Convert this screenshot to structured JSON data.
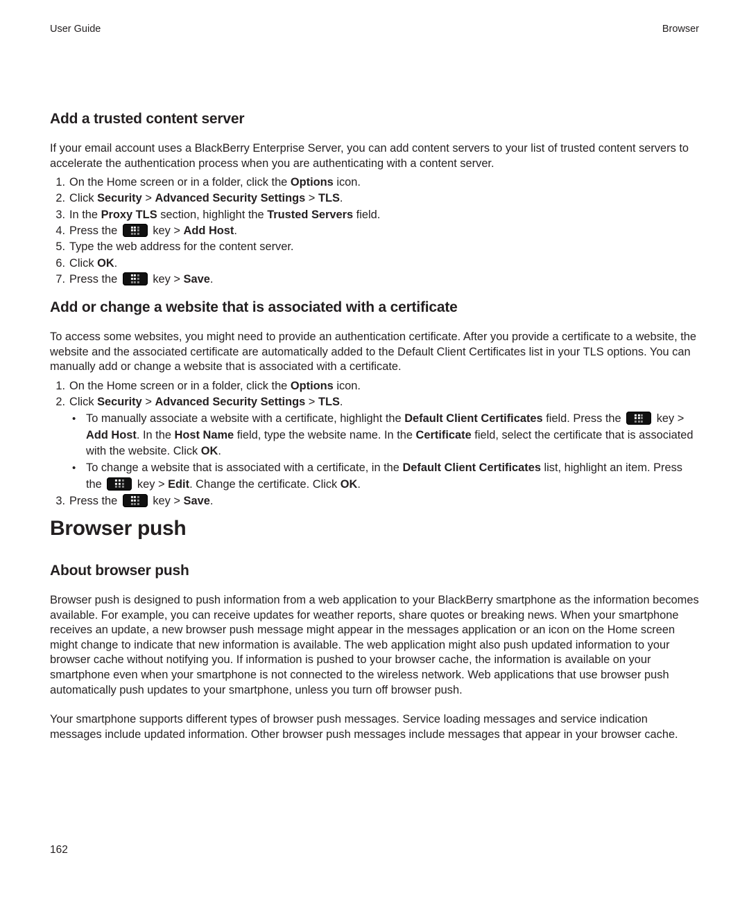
{
  "header": {
    "left": "User Guide",
    "right": "Browser"
  },
  "sections": [
    {
      "id": "trusted-content-server",
      "heading": "Add a trusted content server",
      "intro": "If your email account uses a BlackBerry Enterprise Server, you can add content servers to your list of trusted content servers to accelerate the authentication process when you are authenticating with a content server.",
      "steps": [
        {
          "num": "1.",
          "parts": [
            {
              "t": "On the Home screen or in a folder, click the "
            },
            {
              "t": "Options",
              "b": true
            },
            {
              "t": " icon."
            }
          ]
        },
        {
          "num": "2.",
          "parts": [
            {
              "t": "Click "
            },
            {
              "t": "Security",
              "b": true
            },
            {
              "t": " > "
            },
            {
              "t": "Advanced Security Settings",
              "b": true
            },
            {
              "t": " > "
            },
            {
              "t": "TLS",
              "b": true
            },
            {
              "t": "."
            }
          ]
        },
        {
          "num": "3.",
          "parts": [
            {
              "t": "In the "
            },
            {
              "t": "Proxy TLS",
              "b": true
            },
            {
              "t": " section, highlight the "
            },
            {
              "t": "Trusted Servers",
              "b": true
            },
            {
              "t": " field."
            }
          ]
        },
        {
          "num": "4.",
          "parts": [
            {
              "t": "Press the "
            },
            {
              "icon": "menu-key-icon"
            },
            {
              "t": " key > "
            },
            {
              "t": "Add Host",
              "b": true
            },
            {
              "t": "."
            }
          ]
        },
        {
          "num": "5.",
          "parts": [
            {
              "t": "Type the web address for the content server."
            }
          ]
        },
        {
          "num": "6.",
          "parts": [
            {
              "t": "Click "
            },
            {
              "t": "OK",
              "b": true
            },
            {
              "t": "."
            }
          ]
        },
        {
          "num": "7.",
          "parts": [
            {
              "t": "Press the "
            },
            {
              "icon": "menu-key-icon"
            },
            {
              "t": " key > "
            },
            {
              "t": "Save",
              "b": true
            },
            {
              "t": "."
            }
          ]
        }
      ]
    },
    {
      "id": "website-certificate",
      "heading": "Add or change a website that is associated with a certificate",
      "intro": "To access some websites, you might need to provide an authentication certificate. After you provide a certificate to a website, the website and the associated certificate are automatically added to the Default Client Certificates list in your TLS options. You can manually add or change a website that is associated with a certificate.",
      "steps": [
        {
          "num": "1.",
          "parts": [
            {
              "t": "On the Home screen or in a folder, click the "
            },
            {
              "t": "Options",
              "b": true
            },
            {
              "t": " icon."
            }
          ]
        },
        {
          "num": "2.",
          "parts": [
            {
              "t": "Click "
            },
            {
              "t": "Security",
              "b": true
            },
            {
              "t": " > "
            },
            {
              "t": "Advanced Security Settings",
              "b": true
            },
            {
              "t": " > "
            },
            {
              "t": "TLS",
              "b": true
            },
            {
              "t": "."
            }
          ]
        }
      ],
      "bullets": [
        {
          "parts": [
            {
              "t": "To manually associate a website with a certificate, highlight the "
            },
            {
              "t": "Default Client Certificates",
              "b": true
            },
            {
              "t": " field. Press the "
            },
            {
              "icon": "menu-key-icon"
            },
            {
              "t": " key > "
            },
            {
              "t": "Add Host",
              "b": true
            },
            {
              "t": ". In the "
            },
            {
              "t": "Host Name",
              "b": true
            },
            {
              "t": " field, type the website name. In the "
            },
            {
              "t": "Certificate",
              "b": true
            },
            {
              "t": " field, select the certificate that is associated with the website. Click "
            },
            {
              "t": "OK",
              "b": true
            },
            {
              "t": "."
            }
          ]
        },
        {
          "parts": [
            {
              "t": "To change a website that is associated with a certificate, in the "
            },
            {
              "t": "Default Client Certificates",
              "b": true
            },
            {
              "t": " list, highlight an item. Press the "
            },
            {
              "icon": "menu-key-icon"
            },
            {
              "t": " key > "
            },
            {
              "t": "Edit",
              "b": true
            },
            {
              "t": ". Change the certificate. Click "
            },
            {
              "t": "OK",
              "b": true
            },
            {
              "t": "."
            }
          ]
        }
      ],
      "steps_after": [
        {
          "num": "3.",
          "parts": [
            {
              "t": "Press the "
            },
            {
              "icon": "menu-key-icon"
            },
            {
              "t": " key > "
            },
            {
              "t": "Save",
              "b": true
            },
            {
              "t": "."
            }
          ]
        }
      ]
    },
    {
      "id": "browser-push",
      "title": "Browser push",
      "heading": "About browser push",
      "paragraphs": [
        "Browser push is designed to push information from a web application to your BlackBerry smartphone as the information becomes available. For example, you can receive updates for weather reports, share quotes or breaking news. When your smartphone receives an update, a new browser push message might appear in the messages application or an icon on the Home screen might change to indicate that new information is available. The web application might also push updated information to your browser cache without notifying you. If information is pushed to your browser cache, the information is available on your smartphone even when your smartphone is not connected to the wireless network. Web applications that use browser push automatically push updates to your smartphone, unless you turn off browser push.",
        "Your smartphone supports different types of browser push messages. Service loading messages and service indication messages include updated information. Other browser push messages include messages that appear in your browser cache."
      ]
    }
  ],
  "footer": {
    "page_number": "162"
  }
}
